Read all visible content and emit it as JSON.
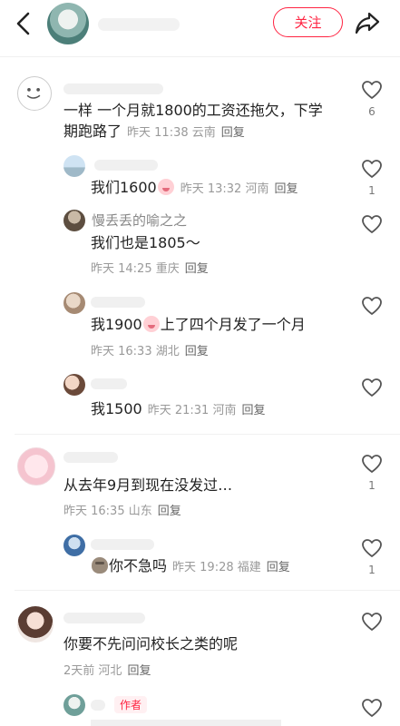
{
  "header": {
    "follow_label": "关注"
  },
  "comments": [
    {
      "content_lines": [
        "一样 一个月就1800的工资还拖欠，下学",
        "期跑路了"
      ],
      "time": "昨天 11:38",
      "location": "云南",
      "reply": "回复",
      "likes": "6",
      "replies": [
        {
          "content": "我们1600",
          "time": "昨天 13:32",
          "location": "河南",
          "reply": "回复",
          "likes": "1"
        },
        {
          "name": "慢丢丢的喻之之",
          "content": "我们也是1805～",
          "time": "昨天 14:25",
          "location": "重庆",
          "reply": "回复"
        },
        {
          "content_a": "我1900",
          "content_b": "上了四个月发了一个月",
          "time": "昨天 16:33",
          "location": "湖北",
          "reply": "回复"
        },
        {
          "content": "我1500",
          "time": "昨天 21:31",
          "location": "河南",
          "reply": "回复"
        }
      ]
    },
    {
      "content": "从去年9月到现在没发过…",
      "time": "昨天 16:35",
      "location": "山东",
      "reply": "回复",
      "likes": "1",
      "replies": [
        {
          "content": "你不急吗",
          "time": "昨天 19:28",
          "location": "福建",
          "reply": "回复",
          "likes": "1"
        }
      ]
    },
    {
      "content": "你要不先问问校长之类的呢",
      "time": "2天前",
      "location": "河北",
      "reply": "回复",
      "replies": [
        {
          "author_tag": "作者"
        }
      ]
    }
  ],
  "icons": {
    "back": "back-arrow-icon",
    "share": "share-icon",
    "like": "heart-outline-icon"
  }
}
